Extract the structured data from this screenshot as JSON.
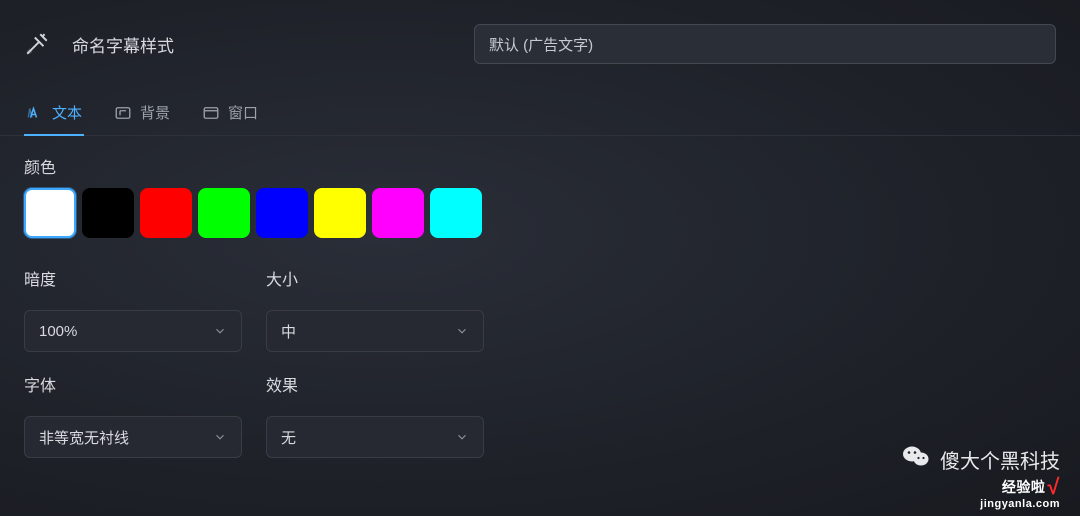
{
  "header": {
    "title": "命名字幕样式",
    "name_input_value": "默认 (广告文字)"
  },
  "tabs": [
    {
      "label": "文本",
      "active": true
    },
    {
      "label": "背景",
      "active": false
    },
    {
      "label": "窗口",
      "active": false
    }
  ],
  "color": {
    "label": "颜色",
    "swatches": [
      {
        "hex": "#ffffff",
        "selected": true
      },
      {
        "hex": "#000000",
        "selected": false
      },
      {
        "hex": "#ff0000",
        "selected": false
      },
      {
        "hex": "#00ff00",
        "selected": false
      },
      {
        "hex": "#0000ff",
        "selected": false
      },
      {
        "hex": "#ffff00",
        "selected": false
      },
      {
        "hex": "#ff00ff",
        "selected": false
      },
      {
        "hex": "#00ffff",
        "selected": false
      }
    ]
  },
  "controls": {
    "opacity": {
      "label": "暗度",
      "value": "100%"
    },
    "size": {
      "label": "大小",
      "value": "中"
    },
    "font": {
      "label": "字体",
      "value": "非等宽无衬线"
    },
    "effect": {
      "label": "效果",
      "value": "无"
    }
  },
  "watermark": {
    "line1": "傻大个黑科技",
    "line2_prefix": "经验啦",
    "line2_domain": "jingyanla.com"
  }
}
